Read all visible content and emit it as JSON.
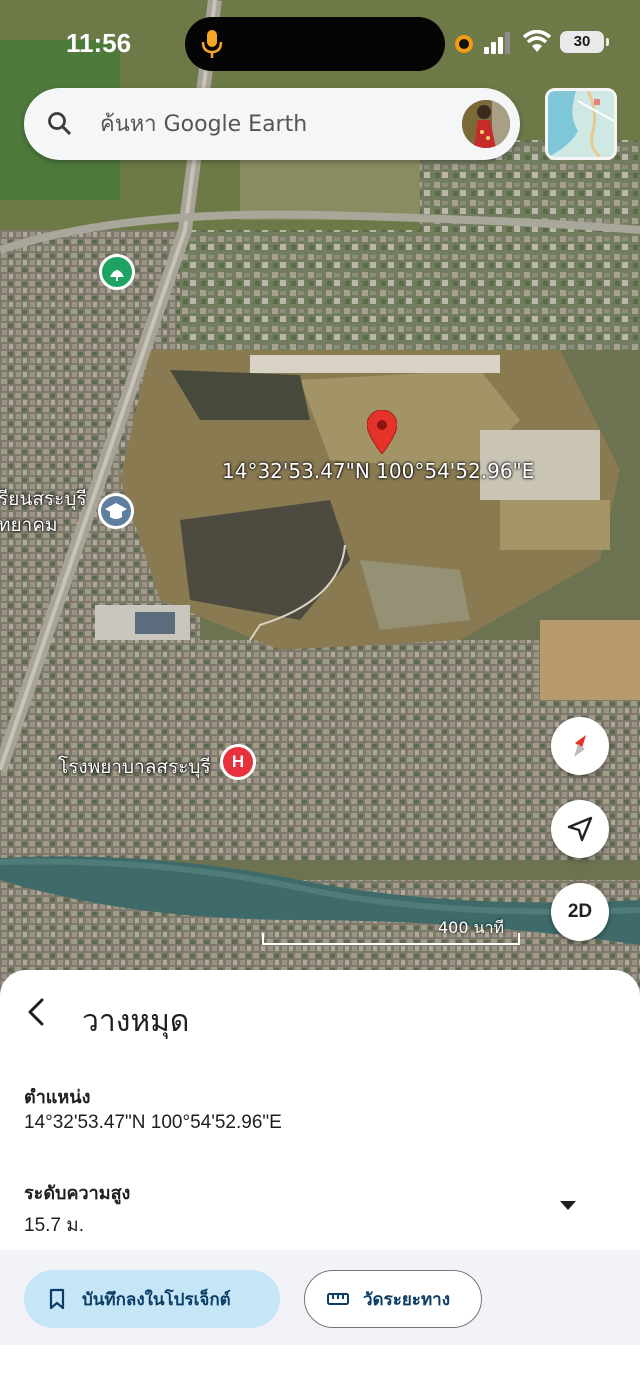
{
  "status_bar": {
    "time": "11:56",
    "battery": "30",
    "icons": [
      "mic-icon",
      "recording-indicator",
      "cellular-signal-icon",
      "wifi-icon",
      "battery-icon"
    ]
  },
  "search": {
    "placeholder": "ค้นหา Google Earth",
    "icon": "search-icon"
  },
  "map": {
    "labels": {
      "school": "รียนสระบุรี\nทยาคม",
      "hospital": "โรงพยาบาลสระบุรี",
      "pin_coordinates": "14°32'53.47\"N 100°54'52.96\"E"
    },
    "controls": {
      "compass": "compass-icon",
      "location": "my-location-icon",
      "view_mode": "2D"
    },
    "scale_label": "400 นาที"
  },
  "sheet": {
    "title": "วางหมุด",
    "position_label": "ตำแหน่ง",
    "position_value": "14°32'53.47\"N 100°54'52.96\"E",
    "altitude_label": "ระดับความสูง",
    "altitude_value": "15.7 ม.",
    "save_label": "บันทึกลงในโปรเจ็กต์",
    "measure_label": "วัดระยะทาง"
  },
  "colors": {
    "pin": "#e5322b",
    "save_button_bg": "#c6e6f8",
    "button_text": "#0b3d66",
    "hospital_badge": "#e5323c"
  }
}
